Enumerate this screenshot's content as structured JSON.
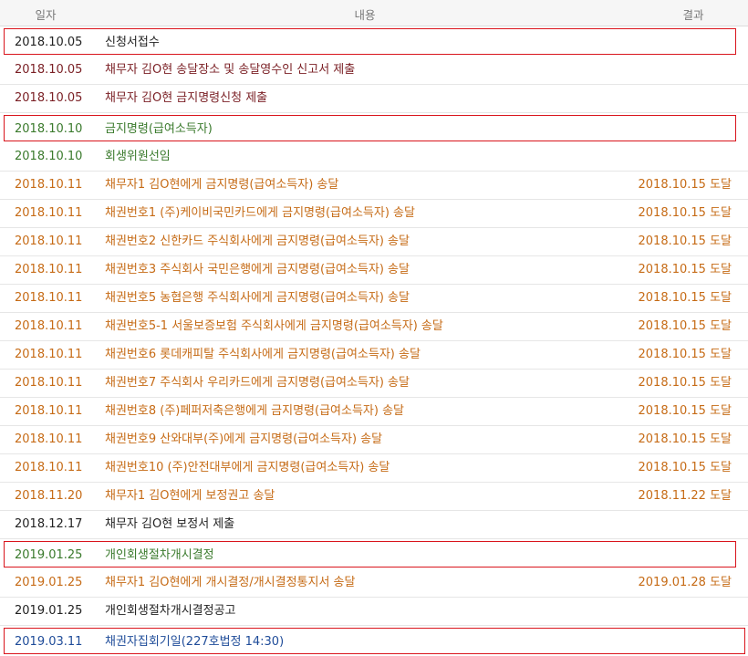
{
  "header": {
    "date": "일자",
    "content": "내용",
    "result": "결과"
  },
  "colors": {
    "black": "#222222",
    "maroon": "#7a1f24",
    "green": "#3a7a2c",
    "orange": "#c66b16",
    "blue": "#1f4c99",
    "highlight_border": "#d9141c"
  },
  "rows": [
    {
      "date": "2018.10.05",
      "content": "신청서접수",
      "result": "",
      "color": "black",
      "highlighted": true
    },
    {
      "date": "2018.10.05",
      "content": "채무자 김O현 송달장소 및 송달영수인 신고서 제출",
      "result": "",
      "color": "maroon",
      "highlighted": false
    },
    {
      "date": "2018.10.05",
      "content": "채무자 김O현 금지명령신청 제출",
      "result": "",
      "color": "maroon",
      "highlighted": false
    },
    {
      "date": "2018.10.10",
      "content": "금지명령(급여소득자)",
      "result": "",
      "color": "green",
      "highlighted": true
    },
    {
      "date": "2018.10.10",
      "content": "회생위원선임",
      "result": "",
      "color": "green",
      "highlighted": false
    },
    {
      "date": "2018.10.11",
      "content": "채무자1 김O현에게 금지명령(급여소득자) 송달",
      "result": "2018.10.15 도달",
      "color": "orange",
      "highlighted": false
    },
    {
      "date": "2018.10.11",
      "content": "채권번호1 (주)케이비국민카드에게 금지명령(급여소득자) 송달",
      "result": "2018.10.15 도달",
      "color": "orange",
      "highlighted": false
    },
    {
      "date": "2018.10.11",
      "content": "채권번호2 신한카드 주식회사에게 금지명령(급여소득자) 송달",
      "result": "2018.10.15 도달",
      "color": "orange",
      "highlighted": false
    },
    {
      "date": "2018.10.11",
      "content": "채권번호3 주식회사 국민은행에게 금지명령(급여소득자) 송달",
      "result": "2018.10.15 도달",
      "color": "orange",
      "highlighted": false
    },
    {
      "date": "2018.10.11",
      "content": "채권번호5 농협은행 주식회사에게 금지명령(급여소득자) 송달",
      "result": "2018.10.15 도달",
      "color": "orange",
      "highlighted": false
    },
    {
      "date": "2018.10.11",
      "content": "채권번호5-1 서울보증보험 주식회사에게 금지명령(급여소득자) 송달",
      "result": "2018.10.15 도달",
      "color": "orange",
      "highlighted": false
    },
    {
      "date": "2018.10.11",
      "content": "채권번호6 롯데캐피탈 주식회사에게 금지명령(급여소득자) 송달",
      "result": "2018.10.15 도달",
      "color": "orange",
      "highlighted": false
    },
    {
      "date": "2018.10.11",
      "content": "채권번호7 주식회사 우리카드에게 금지명령(급여소득자) 송달",
      "result": "2018.10.15 도달",
      "color": "orange",
      "highlighted": false
    },
    {
      "date": "2018.10.11",
      "content": "채권번호8 (주)페퍼저축은행에게 금지명령(급여소득자) 송달",
      "result": "2018.10.15 도달",
      "color": "orange",
      "highlighted": false
    },
    {
      "date": "2018.10.11",
      "content": "채권번호9 산와대부(주)에게 금지명령(급여소득자) 송달",
      "result": "2018.10.15 도달",
      "color": "orange",
      "highlighted": false
    },
    {
      "date": "2018.10.11",
      "content": "채권번호10 (주)안전대부에게 금지명령(급여소득자) 송달",
      "result": "2018.10.15 도달",
      "color": "orange",
      "highlighted": false
    },
    {
      "date": "2018.11.20",
      "content": "채무자1 김O현에게 보정권고 송달",
      "result": "2018.11.22 도달",
      "color": "orange",
      "highlighted": false
    },
    {
      "date": "2018.12.17",
      "content": "채무자 김O현 보정서 제출",
      "result": "",
      "color": "black",
      "highlighted": false
    },
    {
      "date": "2019.01.25",
      "content": "개인회생절차개시결정",
      "result": "",
      "color": "green",
      "highlighted": true
    },
    {
      "date": "2019.01.25",
      "content": "채무자1 김O현에게 개시결정/개시결정통지서 송달",
      "result": "2019.01.28 도달",
      "color": "orange",
      "highlighted": false
    },
    {
      "date": "2019.01.25",
      "content": "개인회생절차개시결정공고",
      "result": "",
      "color": "black",
      "highlighted": false
    },
    {
      "date": "2019.03.11",
      "content": "채권자집회기일(227호법정 14:30)",
      "result": "",
      "color": "blue",
      "highlighted": true
    }
  ]
}
